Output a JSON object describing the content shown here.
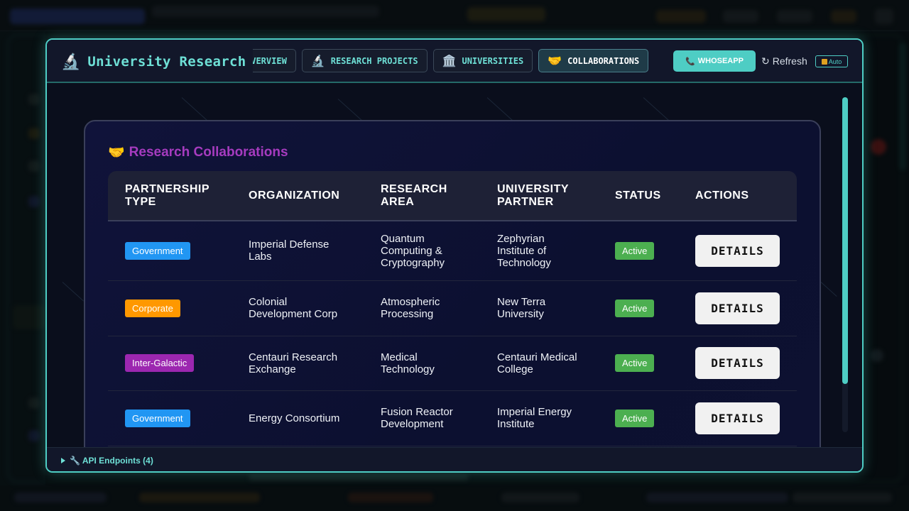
{
  "app": {
    "title": "University Research",
    "icon": "microscope-icon"
  },
  "tabs": [
    {
      "label": "OVERVIEW",
      "icon": "",
      "active": false
    },
    {
      "label": "RESEARCH PROJECTS",
      "icon": "🔬",
      "active": false
    },
    {
      "label": "UNIVERSITIES",
      "icon": "🏛️",
      "active": false
    },
    {
      "label": "COLLABORATIONS",
      "icon": "🤝",
      "active": true
    }
  ],
  "header": {
    "whoseapp_label": "WHOSEAPP",
    "refresh_label": "Refresh",
    "auto_label": "Auto"
  },
  "section": {
    "title": "Research Collaborations",
    "icon": "🤝"
  },
  "table": {
    "columns": [
      "PARTNERSHIP TYPE",
      "ORGANIZATION",
      "RESEARCH AREA",
      "UNIVERSITY PARTNER",
      "STATUS",
      "ACTIONS"
    ],
    "rows": [
      {
        "type": "Government",
        "type_color": "#2196f3",
        "organization": "Imperial Defense Labs",
        "area": "Quantum Computing & Cryptography",
        "partner": "Zephyrian Institute of Technology",
        "status": "Active",
        "action": "DETAILS"
      },
      {
        "type": "Corporate",
        "type_color": "#ff9800",
        "organization": "Colonial Development Corp",
        "area": "Atmospheric Processing",
        "partner": "New Terra University",
        "status": "Active",
        "action": "DETAILS"
      },
      {
        "type": "Inter-Galactic",
        "type_color": "#9c27b0",
        "organization": "Centauri Research Exchange",
        "area": "Medical Technology",
        "partner": "Centauri Medical College",
        "status": "Active",
        "action": "DETAILS"
      },
      {
        "type": "Government",
        "type_color": "#2196f3",
        "organization": "Energy Consortium",
        "area": "Fusion Reactor Development",
        "partner": "Imperial Energy Institute",
        "status": "Active",
        "action": "DETAILS"
      }
    ]
  },
  "footer": {
    "label": "🔧 API Endpoints (4)"
  },
  "colors": {
    "accent": "#4ecdc4",
    "section_title": "#a63bbf",
    "status_active": "#4caf50"
  }
}
